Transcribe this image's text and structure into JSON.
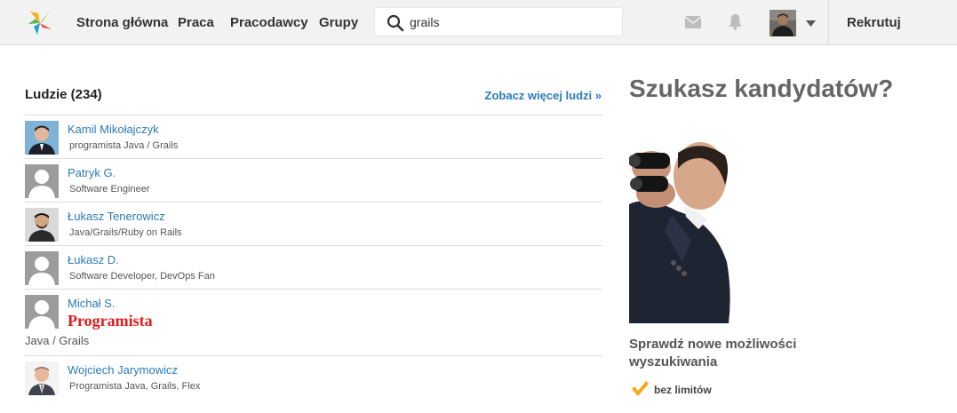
{
  "nav": {
    "items": [
      "Strona główna",
      "Praca",
      "Pracodawcy",
      "Grupy"
    ],
    "search_value": "grails",
    "recruit_label": "Rekrutuj"
  },
  "people": {
    "title": "Ludzie (234)",
    "more_label": "Zobacz więcej ludzi »",
    "items": [
      {
        "name": "Kamil Mikołajczyk",
        "headline": "programista Java / Grails",
        "photo": "photo"
      },
      {
        "name": "Patryk G.",
        "headline": "Software Engineer",
        "photo": "placeholder"
      },
      {
        "name": "Łukasz Tenerowicz",
        "headline": "Java/Grails/Ruby on Rails",
        "photo": "photo"
      },
      {
        "name": "Łukasz D.",
        "headline": "Software Developer, DevOps Fan",
        "photo": "placeholder"
      },
      {
        "name": "Michał S.",
        "big_headline": "Programista",
        "sub_headline": "Java / Grails",
        "photo": "placeholder"
      },
      {
        "name": "Wojciech Jarymowicz",
        "headline": "Programista Java, Grails, Flex",
        "photo": "photo"
      }
    ]
  },
  "ad": {
    "title": "Szukasz kandydatów?",
    "text": "Sprawdź nowe możliwości wyszukiwania",
    "feature": "bez limitów"
  },
  "colors": {
    "link": "#2b7bb9",
    "accent_red": "#e21b1b",
    "topbar": "#f2f2f2",
    "check": "#f7a81b"
  }
}
